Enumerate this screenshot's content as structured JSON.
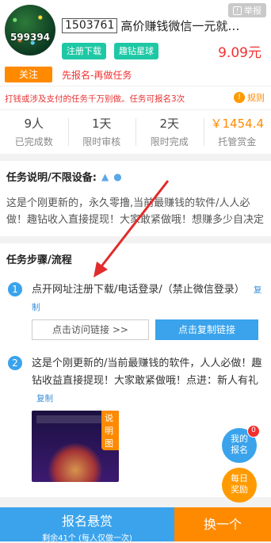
{
  "header": {
    "avatar_text": "599394",
    "follow_label": "关注",
    "report_label": "举报",
    "task_id": "1503761",
    "task_title": "高价赚钱微信一元就…",
    "tags": [
      "注册下载",
      "趣钻星球"
    ],
    "price": "9.09元",
    "apply_note": "先报名-再做任务"
  },
  "notice": {
    "text": "打钱或涉及支付的任务千万别做。任务可报名3次",
    "rules_label": "规则"
  },
  "stats": [
    {
      "value": "9人",
      "label": "已完成数"
    },
    {
      "value": "1天",
      "label": "限时审核"
    },
    {
      "value": "2天",
      "label": "限时完成"
    },
    {
      "value": "￥1454.4",
      "label": "托管赏金"
    }
  ],
  "description": {
    "title": "任务说明/不限设备:",
    "text": "这是个刚更新的，永久零撸,当前最赚钱的软件/人人必做！趣钻收入直接提现！大家敢紧做哦！想赚多少自决定"
  },
  "steps": {
    "title": "任务步骤/流程",
    "items": [
      {
        "num": "1",
        "text": "点开网址注册下载/电话登录/（禁止微信登录）",
        "copy": "复制"
      },
      {
        "num": "2",
        "text": "这是个刚更新的/当前最赚钱的软件，人人必做！趣钻收益直接提现！大家敢紧做哦！点进：新人有礼",
        "copy": "复制"
      }
    ],
    "visit_link_label": "点击访问链接 >>",
    "copy_link_label": "点击复制链接",
    "example_tag": "说明图"
  },
  "floating": {
    "my_apply": "我的\n报名",
    "my_apply_badge": "0",
    "daily_reward": "每日\n奖励"
  },
  "bottom": {
    "signup_label": "报名悬赏",
    "remaining_label": "剩余41个 (每人仅做一次)",
    "switch_label": "换一个"
  },
  "colors": {
    "accent_blue": "#3aa3ec",
    "accent_orange": "#ff8a00",
    "price_red": "#f23030",
    "tag_teal": "#1ec8a5"
  }
}
